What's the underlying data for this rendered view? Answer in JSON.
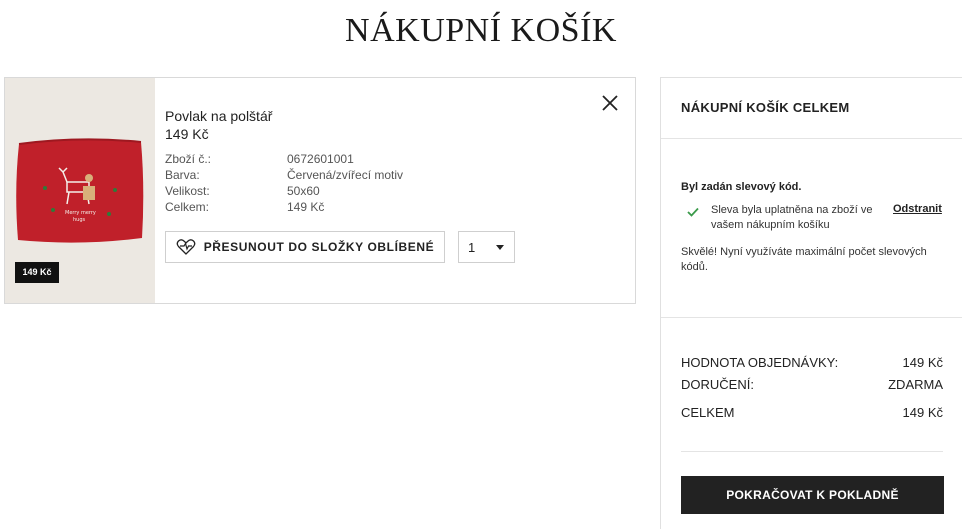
{
  "page": {
    "title": "NÁKUPNÍ KOŠÍK"
  },
  "cart_item": {
    "name": "Povlak na polštář",
    "price": "149 Kč",
    "image_badge": "149 Kč",
    "specs": [
      {
        "label": "Zboží č.:",
        "value": "0672601001"
      },
      {
        "label": "Barva:",
        "value": "Červená/zvířecí motiv"
      },
      {
        "label": "Velikost:",
        "value": "50x60"
      },
      {
        "label": "Celkem:",
        "value": "149 Kč"
      }
    ],
    "favorite_label": "PŘESUNOUT DO SLOŽKY OBLÍBENÉ",
    "quantity": "1",
    "icons": {
      "close": "close-icon",
      "favorite": "heart-icon",
      "dropdown": "caret-down-icon"
    }
  },
  "summary": {
    "title": "NÁKUPNÍ KOŠÍK CELKEM",
    "promo_heading": "Byl zadán slevový kód.",
    "promo_applied": "Sleva byla uplatněna na zboží ve vašem nákupním košíku",
    "remove_label": "Odstranit",
    "promo_note": "Skvělé! Nyní využíváte maximální počet slevových kódů.",
    "order_value_label": "HODNOTA OBJEDNÁVKY:",
    "order_value": "149 Kč",
    "delivery_label": "DORUČENÍ:",
    "delivery_value": "ZDARMA",
    "total_label": "CELKEM",
    "total_value": "149 Kč",
    "checkout_label": "POKRAČOVAT K POKLADNĚ"
  },
  "colors": {
    "accent": "#222222",
    "check": "#3a9a4a",
    "product": "#c0202a"
  }
}
